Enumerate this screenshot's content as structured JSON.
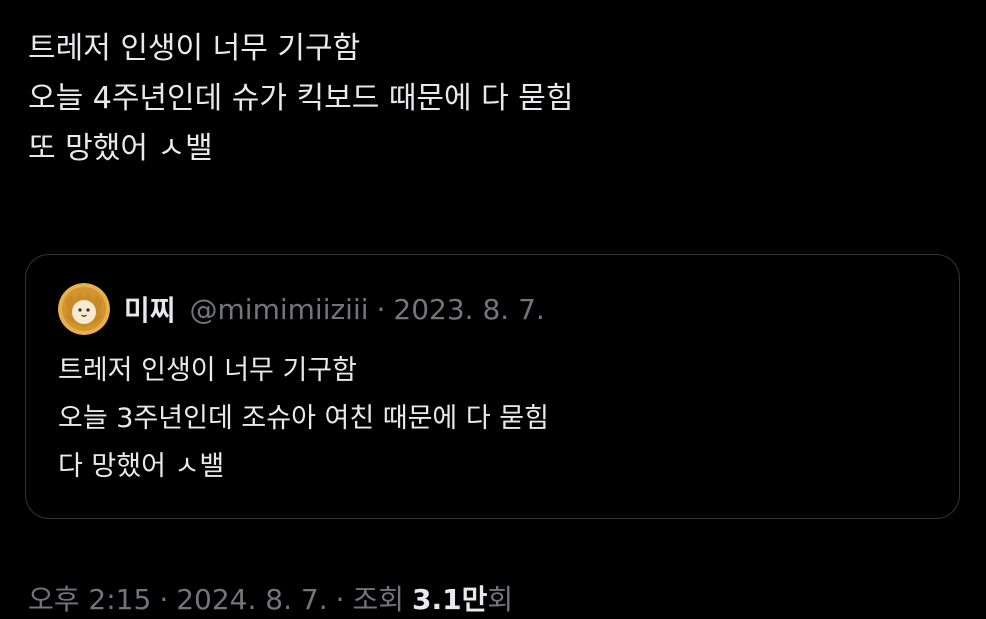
{
  "tweet": {
    "lines": [
      "트레저 인생이 너무 기구함",
      "오늘 4주년인데 슈가 킥보드 때문에 다 묻힘",
      "또 망했어 ㅅ밸"
    ]
  },
  "quote": {
    "display_name": "미찌",
    "handle": "@mimimiiziii",
    "separator": "·",
    "date": "2023. 8. 7.",
    "lines": [
      "트레저 인생이 너무 기구함",
      "오늘 3주년인데 조슈아 여친 때문에 다 묻힘",
      "다 망했어 ㅅ밸"
    ],
    "avatar_icon": "lion-mascot-avatar"
  },
  "meta": {
    "time": "오후 2:15",
    "separator": "·",
    "date": "2024. 8. 7.",
    "views_label": "조회",
    "views_count": "3.1",
    "views_unit": "만",
    "views_suffix": "회"
  },
  "colors": {
    "background": "#000000",
    "text": "#e7e9ea",
    "secondary": "#71767b",
    "border": "#2f3336",
    "avatar": "#e8b04a"
  }
}
